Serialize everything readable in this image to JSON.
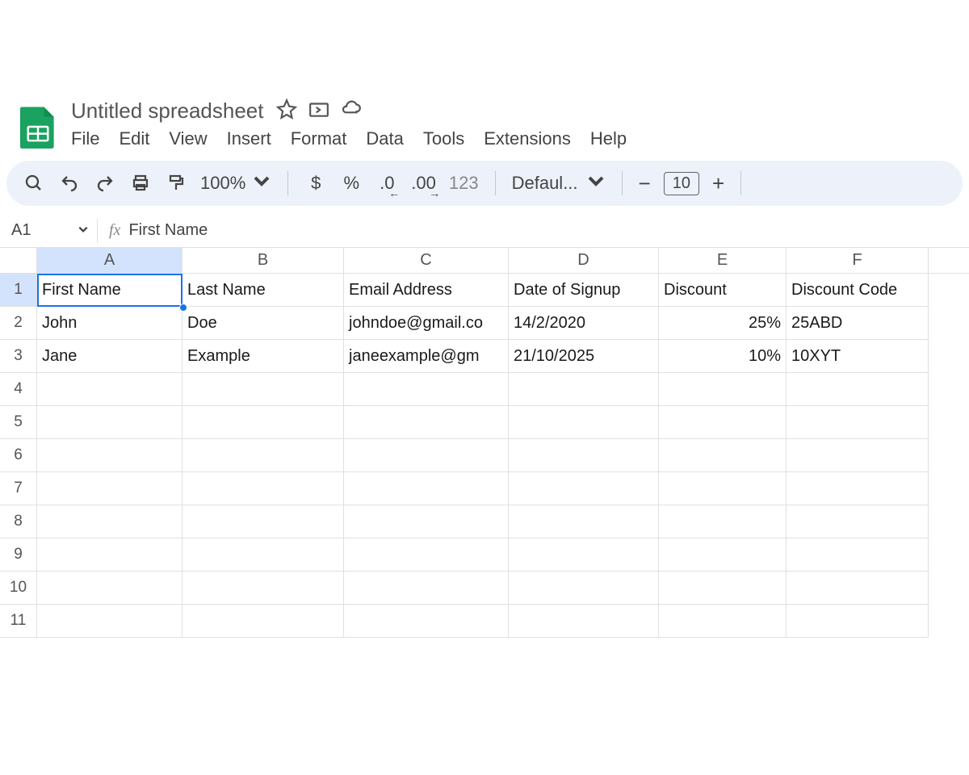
{
  "doc": {
    "title": "Untitled spreadsheet",
    "menu": [
      "File",
      "Edit",
      "View",
      "Insert",
      "Format",
      "Data",
      "Tools",
      "Extensions",
      "Help"
    ]
  },
  "toolbar": {
    "zoom": "100%",
    "currency": "$",
    "percent": "%",
    "dec_decrease": ".0",
    "dec_increase": ".00",
    "numfmt": "123",
    "font": "Defaul...",
    "minus": "−",
    "font_size": "10",
    "plus": "+"
  },
  "name_box": {
    "ref": "A1",
    "fx": "fx",
    "formula": "First Name"
  },
  "columns": [
    "A",
    "B",
    "C",
    "D",
    "E",
    "F"
  ],
  "rows": [
    "1",
    "2",
    "3",
    "4",
    "5",
    "6",
    "7",
    "8",
    "9",
    "10",
    "11"
  ],
  "grid": {
    "r1": {
      "A": "First Name",
      "B": "Last Name",
      "C": "Email Address",
      "D": "Date of Signup",
      "E": "Discount",
      "F": "Discount Code"
    },
    "r2": {
      "A": "John",
      "B": "Doe",
      "C": "johndoe@gmail.co",
      "D": "14/2/2020",
      "E": "25%",
      "F": "25ABD"
    },
    "r3": {
      "A": "Jane",
      "B": "Example",
      "C": "janeexample@gm",
      "D": "21/10/2025",
      "E": "10%",
      "F": "10XYT"
    }
  },
  "selection": {
    "active_col": 0,
    "active_row": 0
  }
}
